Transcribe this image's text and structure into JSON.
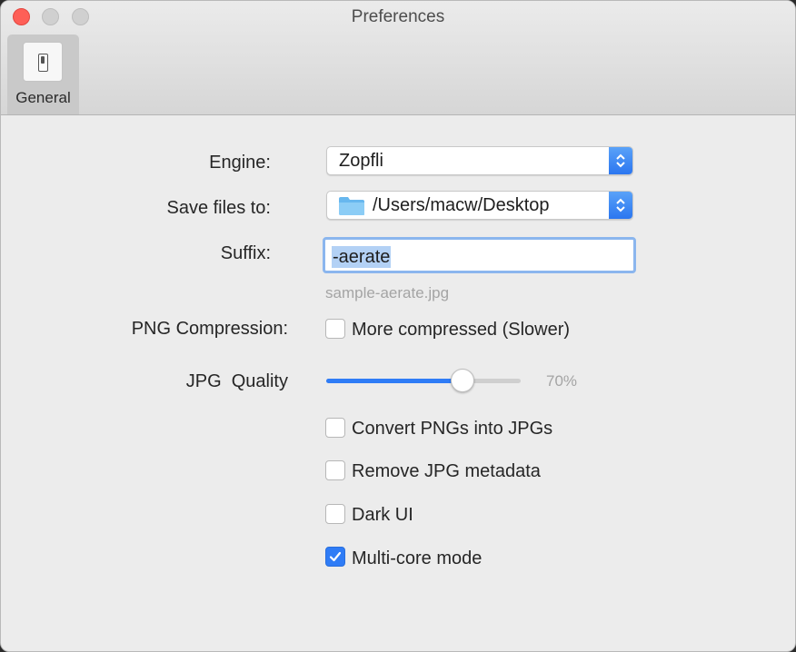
{
  "window": {
    "title": "Preferences"
  },
  "toolbar": {
    "tabs": [
      {
        "label": "General",
        "icon": "switch-icon"
      }
    ]
  },
  "form": {
    "engine": {
      "label": "Engine:",
      "value": "Zopfli"
    },
    "save_to": {
      "label": "Save files to:",
      "value": "/Users/macw/Desktop",
      "icon": "folder-icon"
    },
    "suffix": {
      "label": "Suffix:",
      "value": "-aerate",
      "example": "sample-aerate.jpg"
    },
    "png": {
      "label": "PNG Compression:",
      "option": "More compressed (Slower)",
      "checked": false
    },
    "jpg": {
      "label": "JPG  Quality",
      "value_text": "70%",
      "value": 0.7
    },
    "options": [
      {
        "label": "Convert PNGs into JPGs",
        "checked": false
      },
      {
        "label": "Remove JPG metadata",
        "checked": false
      },
      {
        "label": "Dark UI",
        "checked": false
      },
      {
        "label": "Multi-core mode",
        "checked": true
      }
    ]
  },
  "colors": {
    "accent": "#2f7cf6",
    "close": "#fe5f57"
  }
}
